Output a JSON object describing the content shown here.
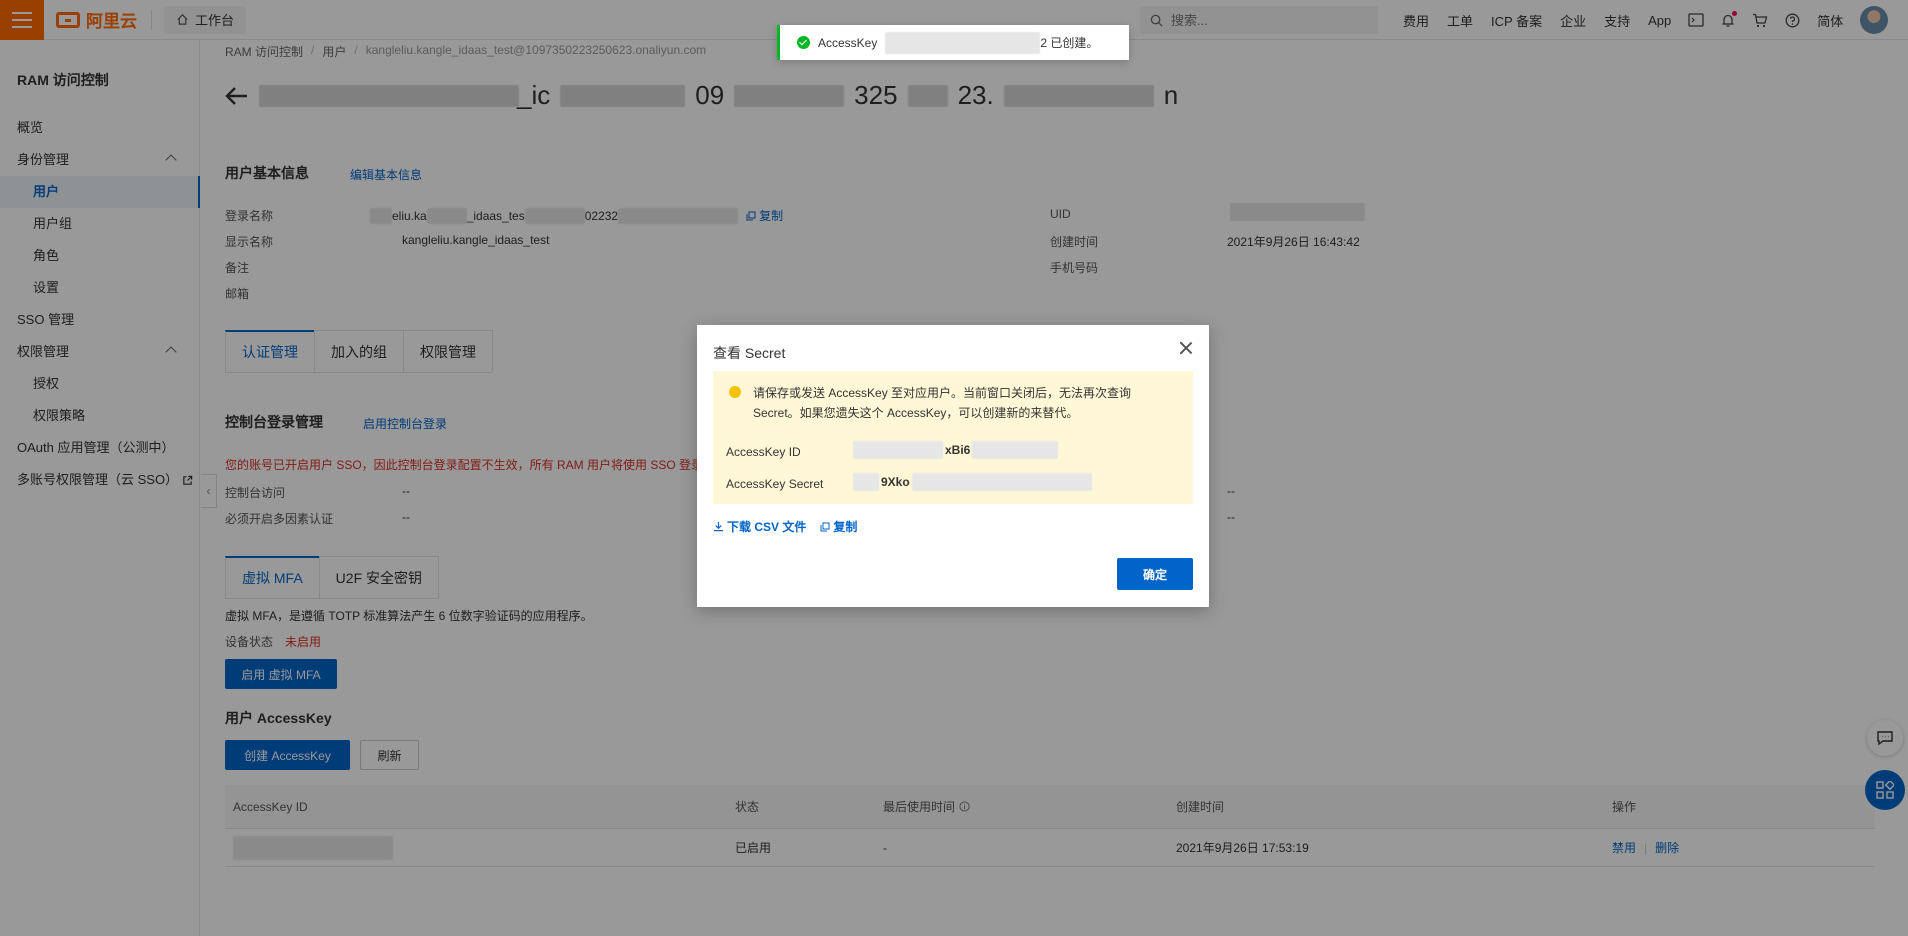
{
  "topbar": {
    "brand": "阿里云",
    "workbench": "工作台",
    "search_placeholder": "搜索...",
    "nav": [
      "费用",
      "工单",
      "ICP 备案",
      "企业",
      "支持",
      "App"
    ],
    "lang": "简体"
  },
  "sidebar": {
    "title": "RAM 访问控制",
    "items": [
      {
        "label": "概览"
      },
      {
        "label": "身份管理"
      },
      {
        "label": "用户"
      },
      {
        "label": "用户组"
      },
      {
        "label": "角色"
      },
      {
        "label": "设置"
      },
      {
        "label": "SSO 管理"
      },
      {
        "label": "权限管理"
      },
      {
        "label": "授权"
      },
      {
        "label": "权限策略"
      },
      {
        "label": "OAuth 应用管理（公测中）"
      },
      {
        "label": "多账号权限管理（云 SSO）"
      }
    ]
  },
  "breadcrumb": [
    "RAM 访问控制",
    "用户",
    "kangleliu.kangle_idaas_test@1097350223250623.onaliyun.com"
  ],
  "title_parts": [
    "_ic",
    "09",
    "325",
    "23.",
    "n"
  ],
  "basic": {
    "section": "用户基本信息",
    "edit": "编辑基本信息",
    "labels": [
      "登录名称",
      "显示名称",
      "备注",
      "邮箱",
      "UID",
      "创建时间",
      "手机号码"
    ],
    "login_name_parts": [
      "eliu.ka",
      "_idaas_tes",
      "02232"
    ],
    "copy": "复制",
    "display_name": "kangleliu.kangle_idaas_test",
    "created": "2021年9月26日 16:43:42"
  },
  "tabs": [
    "认证管理",
    "加入的组",
    "权限管理"
  ],
  "console": {
    "section": "控制台登录管理",
    "enable": "启用控制台登录",
    "warning": "您的账号已开启用户 SSO，因此控制台登录配置不生效，所有 RAM 用户将使用 SSO 登录",
    "labels": [
      "控制台访问",
      "必须开启多因素认证"
    ],
    "values": [
      "--",
      "--",
      "--",
      "--"
    ]
  },
  "mfa": {
    "tabs": [
      "虚拟 MFA",
      "U2F 安全密钥"
    ],
    "desc": "虚拟 MFA，是遵循 TOTP 标准算法产生 6 位数字验证码的应用程序。",
    "status_label": "设备状态",
    "status_value": "未启用",
    "enable_button": "启用 虚拟 MFA"
  },
  "accesskey": {
    "section": "用户 AccessKey",
    "create": "创建 AccessKey",
    "refresh": "刷新",
    "columns": [
      "AccessKey ID",
      "状态",
      "最后使用时间",
      "创建时间",
      "操作"
    ],
    "row": {
      "status": "已启用",
      "last_used": "-",
      "created": "2021年9月26日 17:53:19",
      "actions": [
        "禁用",
        "删除"
      ]
    }
  },
  "toast": {
    "prefix": "AccessKey",
    "suffix": "2 已创建。"
  },
  "dialog": {
    "title": "查看 Secret",
    "notice": "请保存或发送 AccessKey 至对应用户。当前窗口关闭后，无法再次查询 Secret。如果您遗失这个 AccessKey，可以创建新的来替代。",
    "id_label": "AccessKey ID",
    "id_partial": "xBi6",
    "secret_label": "AccessKey Secret",
    "secret_partial": "9Xko",
    "download": "下载 CSV 文件",
    "copy": "复制",
    "ok": "确定"
  }
}
